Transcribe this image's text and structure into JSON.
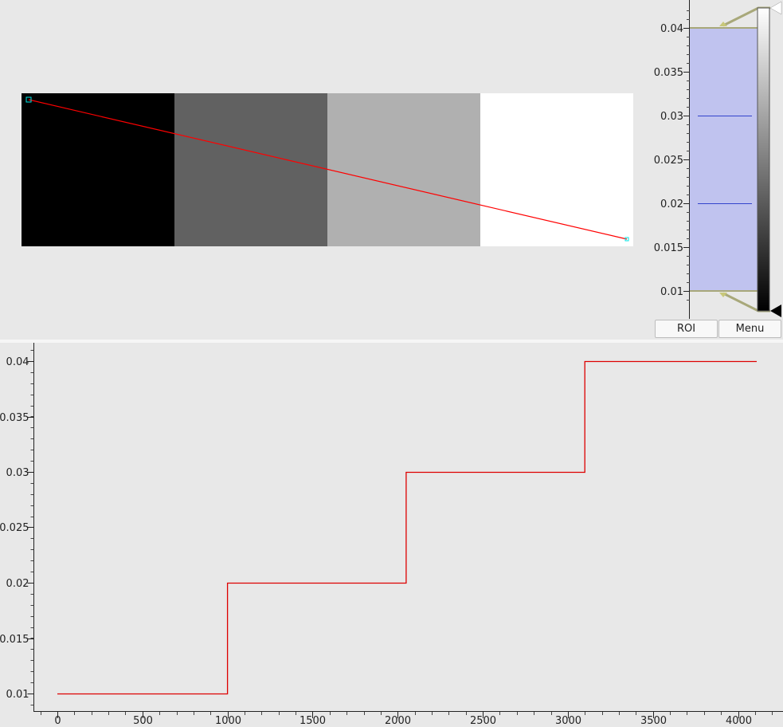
{
  "image_view": {
    "gray_blocks": [
      "#000000",
      "#616161",
      "#b0b0b0",
      "#ffffff"
    ],
    "roi_line_color": "#ff0000",
    "handle_color": "#00e5e5"
  },
  "histogram": {
    "ticks": [
      "0.01",
      "0.015",
      "0.02",
      "0.025",
      "0.03",
      "0.035",
      "0.04"
    ],
    "region_color": "#c0c3ef",
    "gradient_top": "#ffffff",
    "gradient_bottom": "#000000"
  },
  "buttons": {
    "roi": "ROI",
    "menu": "Menu"
  },
  "chart_data": {
    "type": "line",
    "title": "",
    "xlabel": "",
    "ylabel": "",
    "xlim": [
      -150,
      4200
    ],
    "ylim": [
      0.0085,
      0.0413
    ],
    "x_ticks": [
      "0",
      "500",
      "1000",
      "1500",
      "2000",
      "2500",
      "3000",
      "3500",
      "4000"
    ],
    "y_ticks": [
      "0.01",
      "0.015",
      "0.02",
      "0.025",
      "0.03",
      "0.035",
      "0.04"
    ],
    "line_color": "#dd0000",
    "series": [
      {
        "x": [
          0,
          1000,
          1000,
          2050,
          2050,
          3100,
          3100,
          4110
        ],
        "y": [
          0.01,
          0.01,
          0.02,
          0.02,
          0.03,
          0.03,
          0.04,
          0.04
        ]
      }
    ]
  }
}
